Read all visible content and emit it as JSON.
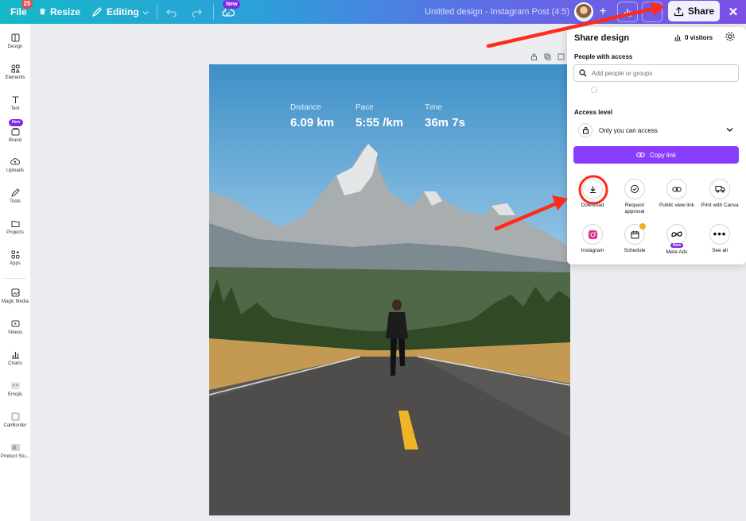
{
  "topbar": {
    "file_label": "File",
    "file_badge": "25",
    "resize_label": "Resize",
    "editing_label": "Editing",
    "new_badge": "New",
    "design_title": "Untitled design - Instagram Post (4:5)",
    "share_label": "Share"
  },
  "sidebar": {
    "items": [
      {
        "label": "Design",
        "icon": "layout-icon"
      },
      {
        "label": "Elements",
        "icon": "shapes-icon"
      },
      {
        "label": "Text",
        "icon": "text-icon"
      },
      {
        "label": "Brand",
        "icon": "brand-icon",
        "badge": "New"
      },
      {
        "label": "Uploads",
        "icon": "cloud-upload-icon"
      },
      {
        "label": "Tools",
        "icon": "pen-icon"
      },
      {
        "label": "Projects",
        "icon": "folder-icon"
      },
      {
        "label": "Apps",
        "icon": "apps-icon"
      },
      {
        "label": "Magic Media",
        "icon": "magic-media-icon"
      },
      {
        "label": "Videos",
        "icon": "video-icon"
      },
      {
        "label": "Charts",
        "icon": "chart-icon"
      },
      {
        "label": "Emojis",
        "icon": "emoji-icon"
      },
      {
        "label": "CanBorder",
        "icon": "border-icon"
      },
      {
        "label": "Product Stu...",
        "icon": "product-icon"
      }
    ]
  },
  "design": {
    "stats": [
      {
        "label": "Distance",
        "value": "6.09 km"
      },
      {
        "label": "Pace",
        "value": "5:55 /km"
      },
      {
        "label": "Time",
        "value": "36m 7s"
      }
    ]
  },
  "share_panel": {
    "title": "Share design",
    "visitors": "0 visitors",
    "people_label": "People with access",
    "search_placeholder": "Add people or groups",
    "access_label": "Access level",
    "access_value": "Only you can access",
    "copy_link": "Copy link",
    "options": [
      {
        "label": "Download",
        "icon": "download-icon"
      },
      {
        "label": "Request approval",
        "icon": "check-circle-icon"
      },
      {
        "label": "Public view link",
        "icon": "link-icon"
      },
      {
        "label": "Print with Canva",
        "icon": "truck-icon"
      },
      {
        "label": "Instagram",
        "icon": "instagram-icon"
      },
      {
        "label": "Schedule",
        "icon": "calendar-icon"
      },
      {
        "label": "Meta Ads",
        "icon": "meta-icon",
        "badge": "New"
      },
      {
        "label": "See all",
        "icon": "more-icon"
      }
    ]
  },
  "colors": {
    "accent": "#8b3dff",
    "annotation": "#ff2a1a"
  }
}
